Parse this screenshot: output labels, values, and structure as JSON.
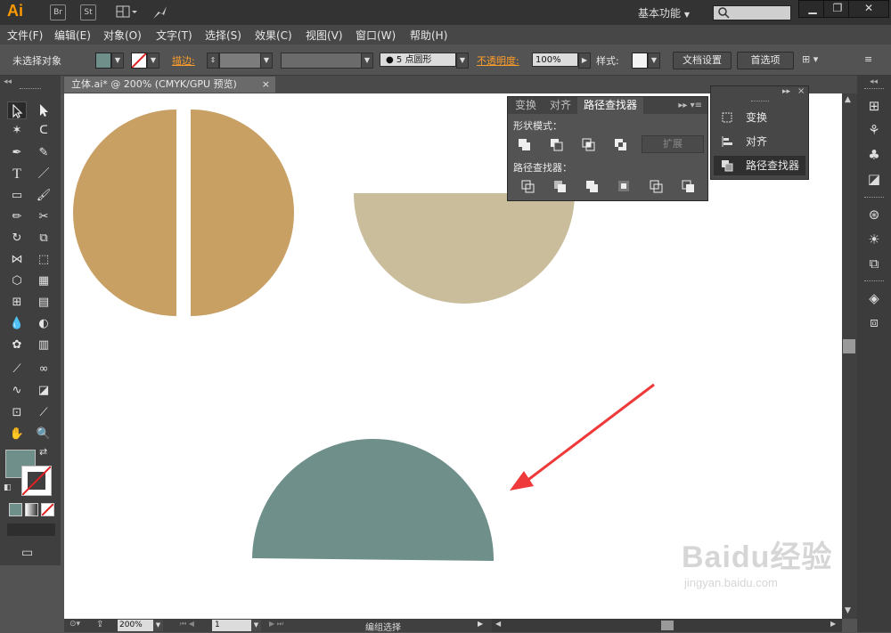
{
  "app": {
    "logo": "Ai",
    "bridge": "Br",
    "stock": "St",
    "workspace": "基本功能",
    "window_min": "▁",
    "window_restore": "❐",
    "window_close": "✕"
  },
  "menu": [
    "文件(F)",
    "编辑(E)",
    "对象(O)",
    "文字(T)",
    "选择(S)",
    "效果(C)",
    "视图(V)",
    "窗口(W)",
    "帮助(H)"
  ],
  "control": {
    "selection_status": "未选择对象",
    "stroke_label": "描边",
    "brush_value": "5 点圆形",
    "opacity_label": "不透明度",
    "opacity_value": "100%",
    "style_label": "样式",
    "doc_settings": "文档设置",
    "preferences": "首选项",
    "fill_color": "#6f8f8b"
  },
  "document": {
    "tab_title": "立体.ai* @ 200% (CMYK/GPU 预览)",
    "close": "×"
  },
  "pathfinder_panel": {
    "tabs": [
      "变换",
      "对齐",
      "路径查找器"
    ],
    "active_tab": "路径查找器",
    "shape_modes_label": "形状模式：",
    "expand_label": "扩展",
    "pathfinders_label": "路径查找器："
  },
  "panel_menu": {
    "items": [
      {
        "label": "变换",
        "icon": "transform-icon"
      },
      {
        "label": "对齐",
        "icon": "align-icon"
      },
      {
        "label": "路径查找器",
        "icon": "pathfinder-icon",
        "selected": true
      }
    ]
  },
  "artwork": {
    "circle_color": "#c8a064",
    "top_half_color": "#c9bd9c",
    "bottom_half_color": "#6f8f8a",
    "arrow_color": "#ee3a3a"
  },
  "status": {
    "zoom": "200%",
    "page": "1",
    "selection_tool": "编组选择"
  },
  "watermark": {
    "brand": "Baidu经验",
    "url": "jingyan.baidu.com"
  }
}
